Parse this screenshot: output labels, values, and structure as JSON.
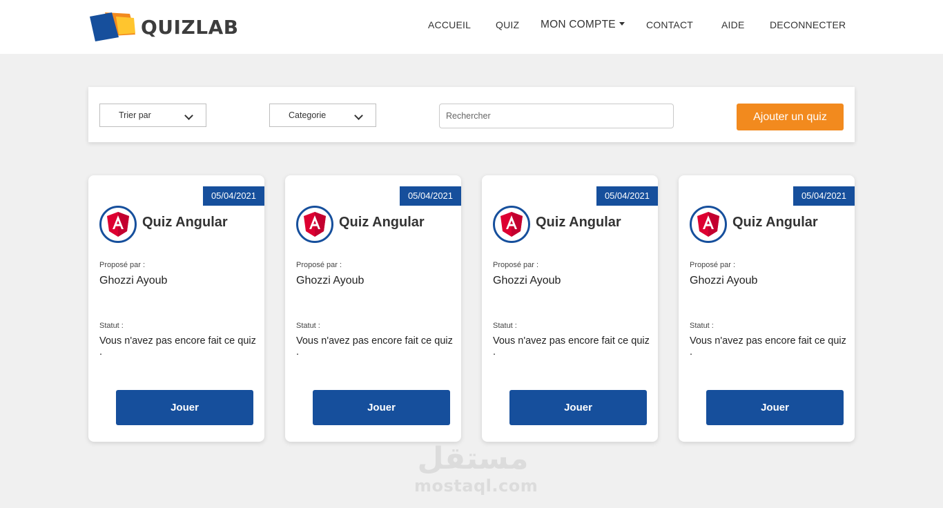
{
  "header": {
    "brand": "QUIZLAB",
    "nav": [
      {
        "label": "ACCUEIL",
        "has_caret": false
      },
      {
        "label": "QUIZ",
        "has_caret": false
      },
      {
        "label": "MON COMPTE",
        "has_caret": true
      },
      {
        "label": "CONTACT",
        "has_caret": false
      },
      {
        "label": "AIDE",
        "has_caret": false
      },
      {
        "label": "DECONNECTER",
        "has_caret": false
      }
    ]
  },
  "filters": {
    "sort_label": "Trier par",
    "category_label": "Categorie",
    "search_placeholder": "Rechercher",
    "add_button": "Ajouter un quiz"
  },
  "cards": [
    {
      "date": "05/04/2021",
      "icon": "angular-icon",
      "title": "Quiz Angular",
      "proposed_label": "Proposé par :",
      "author": "Ghozzi Ayoub",
      "status_label": "Statut :",
      "status": "Vous n'avez pas encore fait ce quiz .",
      "play_button": "Jouer"
    },
    {
      "date": "05/04/2021",
      "icon": "angular-icon",
      "title": "Quiz Angular",
      "proposed_label": "Proposé par :",
      "author": "Ghozzi Ayoub",
      "status_label": "Statut :",
      "status": "Vous n'avez pas encore fait ce quiz .",
      "play_button": "Jouer"
    },
    {
      "date": "05/04/2021",
      "icon": "angular-icon",
      "title": "Quiz Angular",
      "proposed_label": "Proposé par :",
      "author": "Ghozzi Ayoub",
      "status_label": "Statut :",
      "status": "Vous n'avez pas encore fait ce quiz .",
      "play_button": "Jouer"
    },
    {
      "date": "05/04/2021",
      "icon": "angular-icon",
      "title": "Quiz Angular",
      "proposed_label": "Proposé par :",
      "author": "Ghozzi Ayoub",
      "status_label": "Statut :",
      "status": "Vous n'avez pas encore fait ce quiz .",
      "play_button": "Jouer"
    }
  ],
  "watermark": {
    "arabic": "مستقل",
    "latin": "mostaql.com"
  },
  "colors": {
    "primary_blue": "#164f9c",
    "accent_orange": "#f28a1e",
    "angular_red": "#dd0031",
    "background": "#f0f0f0"
  }
}
